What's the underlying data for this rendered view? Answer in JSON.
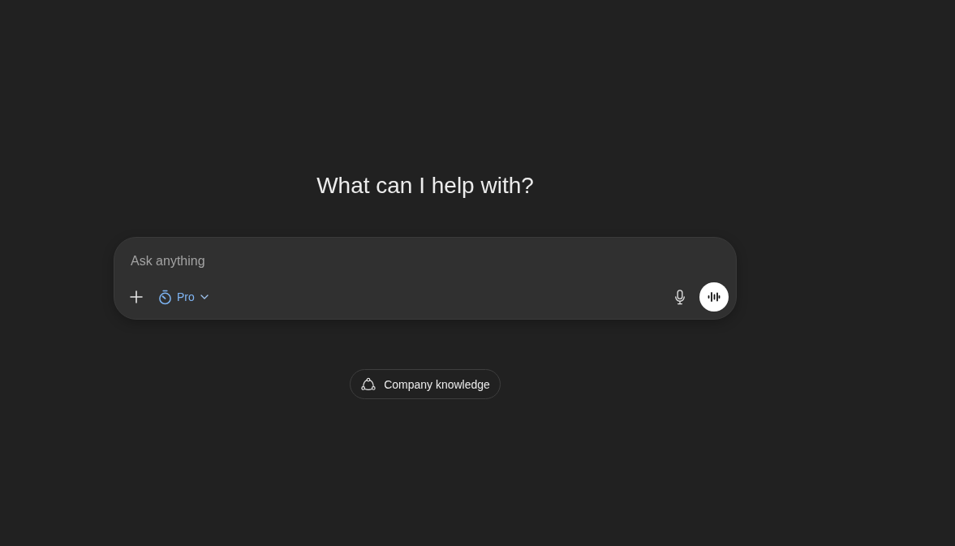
{
  "heading": "What can I help with?",
  "composer": {
    "placeholder": "Ask anything",
    "model": {
      "label": "Pro"
    }
  },
  "suggestions": [
    {
      "label": "Company knowledge"
    }
  ]
}
